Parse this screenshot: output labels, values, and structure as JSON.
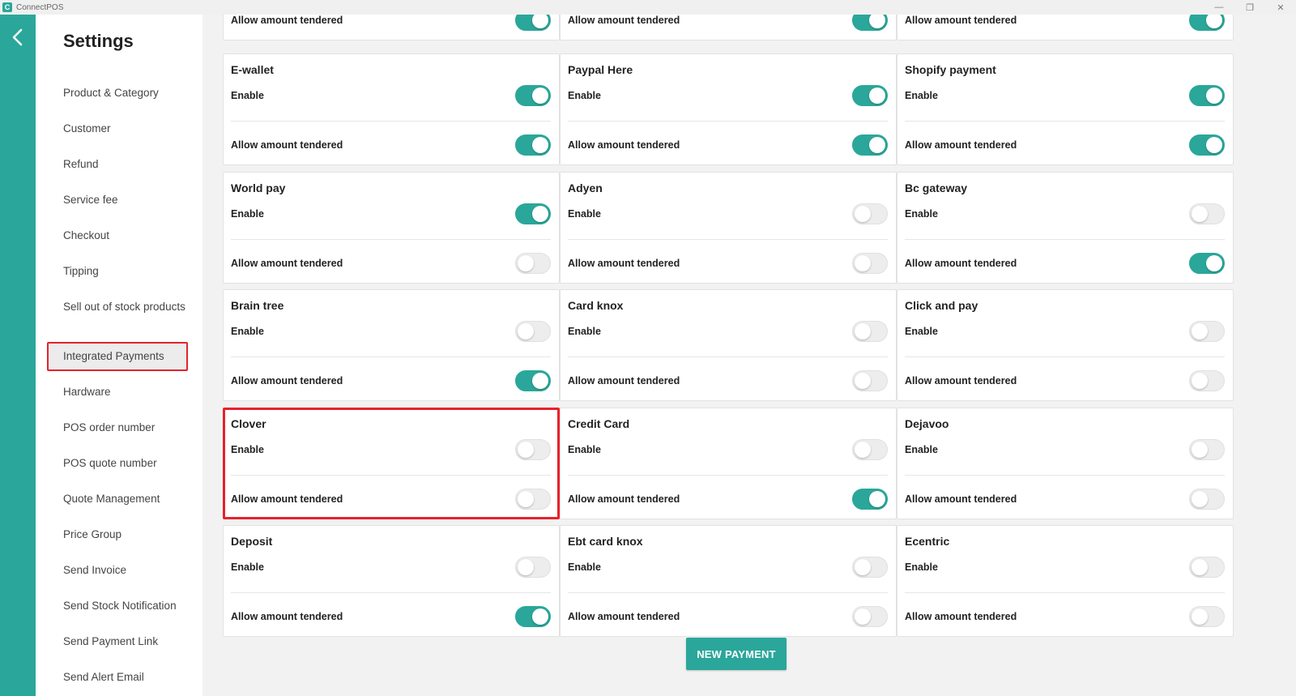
{
  "window": {
    "title": "ConnectPOS",
    "icon_letter": "C"
  },
  "sidebar": {
    "title": "Settings",
    "items": [
      {
        "label": "Product & Category",
        "active": false
      },
      {
        "label": "Customer",
        "active": false
      },
      {
        "label": "Refund",
        "active": false
      },
      {
        "label": "Service fee",
        "active": false
      },
      {
        "label": "Checkout",
        "active": false
      },
      {
        "label": "Tipping",
        "active": false
      },
      {
        "label": "Sell out of stock products",
        "active": false
      },
      {
        "label": "Integrated Payments",
        "active": true
      },
      {
        "label": "Hardware",
        "active": false
      },
      {
        "label": "POS order number",
        "active": false
      },
      {
        "label": "POS quote number",
        "active": false
      },
      {
        "label": "Quote Management",
        "active": false
      },
      {
        "label": "Price Group",
        "active": false
      },
      {
        "label": "Send Invoice",
        "active": false
      },
      {
        "label": "Send Stock Notification",
        "active": false
      },
      {
        "label": "Send Payment Link",
        "active": false
      },
      {
        "label": "Send Alert Email",
        "active": false
      }
    ]
  },
  "labels": {
    "enable": "Enable",
    "allow": "Allow amount tendered"
  },
  "payments": [
    {
      "name": "",
      "enable": true,
      "allow": true
    },
    {
      "name": "",
      "enable": true,
      "allow": true
    },
    {
      "name": "",
      "enable": true,
      "allow": true
    },
    {
      "name": "E-wallet",
      "enable": true,
      "allow": true
    },
    {
      "name": "Paypal Here",
      "enable": true,
      "allow": true
    },
    {
      "name": "Shopify payment",
      "enable": true,
      "allow": true
    },
    {
      "name": "World pay",
      "enable": true,
      "allow": false
    },
    {
      "name": "Adyen",
      "enable": false,
      "allow": false
    },
    {
      "name": "Bc gateway",
      "enable": false,
      "allow": true
    },
    {
      "name": "Brain tree",
      "enable": false,
      "allow": true
    },
    {
      "name": "Card knox",
      "enable": false,
      "allow": false
    },
    {
      "name": "Click and pay",
      "enable": false,
      "allow": false
    },
    {
      "name": "Clover",
      "enable": false,
      "allow": false,
      "highlighted": true
    },
    {
      "name": "Credit Card",
      "enable": false,
      "allow": true
    },
    {
      "name": "Dejavoo",
      "enable": false,
      "allow": false
    },
    {
      "name": "Deposit",
      "enable": false,
      "allow": true
    },
    {
      "name": "Ebt card knox",
      "enable": false,
      "allow": false
    },
    {
      "name": "Ecentric",
      "enable": false,
      "allow": false
    }
  ],
  "actions": {
    "new_payment": "NEW PAYMENT"
  },
  "colors": {
    "accent": "#2aa79a",
    "highlight": "#e8212a"
  }
}
